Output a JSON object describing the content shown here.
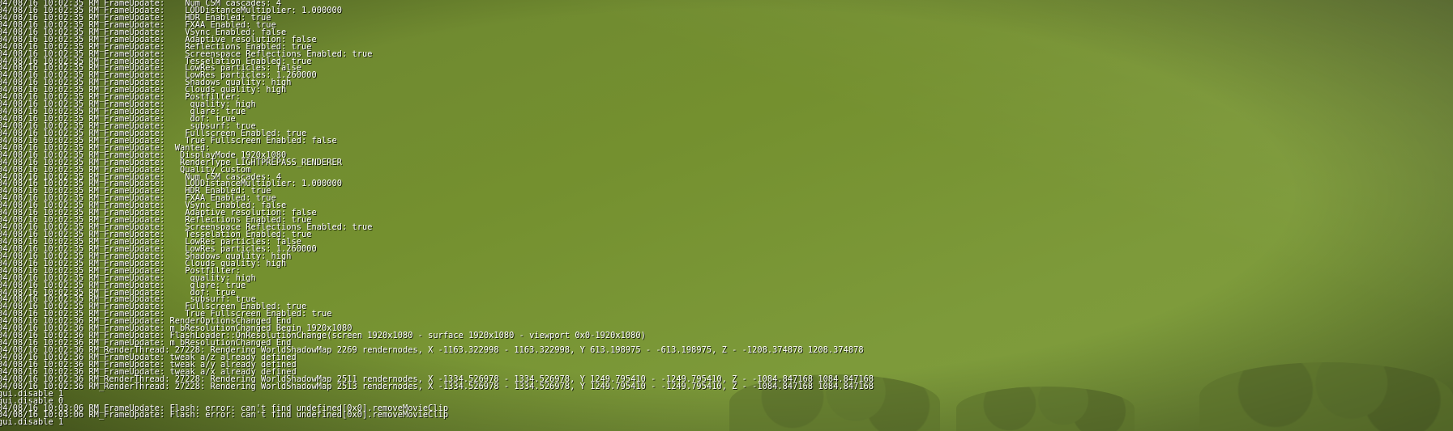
{
  "log_lines": [
    "04/08/16 10:02:35 RM_FrameUpdate:    Num CSM cascades: 4",
    "04/08/16 10:02:35 RM_FrameUpdate:    LODDistanceMultiplier: 1.000000",
    "04/08/16 10:02:35 RM_FrameUpdate:    HDR Enabled: true",
    "04/08/16 10:02:35 RM_FrameUpdate:    FXAA Enabled: true",
    "04/08/16 10:02:35 RM_FrameUpdate:    VSync Enabled: false",
    "04/08/16 10:02:35 RM_FrameUpdate:    Adaptive resolution: false",
    "04/08/16 10:02:35 RM_FrameUpdate:    Reflections Enabled: true",
    "04/08/16 10:02:35 RM_FrameUpdate:    Screenspace Reflections Enabled: true",
    "04/08/16 10:02:35 RM_FrameUpdate:    Tesselation Enabled: true",
    "04/08/16 10:02:35 RM_FrameUpdate:    LowRes particles: false",
    "04/08/16 10:02:35 RM_FrameUpdate:    LowRes particles: 1.260000",
    "04/08/16 10:02:35 RM_FrameUpdate:    Shadows quality: high",
    "04/08/16 10:02:35 RM_FrameUpdate:    Clouds quality: high",
    "04/08/16 10:02:35 RM_FrameUpdate:    Postfilter:",
    "04/08/16 10:02:35 RM_FrameUpdate:     quality: high",
    "04/08/16 10:02:35 RM_FrameUpdate:     glare: true",
    "04/08/16 10:02:35 RM_FrameUpdate:     dof: true",
    "04/08/16 10:02:35 RM_FrameUpdate:     subsurf: true",
    "04/08/16 10:02:35 RM_FrameUpdate:    Fullscreen Enabled: true",
    "04/08/16 10:02:35 RM_FrameUpdate:    True Fullscreen Enabled: false",
    "04/08/16 10:02:35 RM_FrameUpdate:  Wanted:",
    "04/08/16 10:02:35 RM_FrameUpdate:   DisplayMode 1920x1080",
    "04/08/16 10:02:35 RM_FrameUpdate:   RenderType LIGHTPREPASS_RENDERER",
    "04/08/16 10:02:35 RM_FrameUpdate:   Quality custom",
    "04/08/16 10:02:35 RM_FrameUpdate:    Num CSM cascades: 4",
    "04/08/16 10:02:35 RM_FrameUpdate:    LODDistanceMultiplier: 1.000000",
    "04/08/16 10:02:35 RM_FrameUpdate:    HDR Enabled: true",
    "04/08/16 10:02:35 RM_FrameUpdate:    FXAA Enabled: true",
    "04/08/16 10:02:35 RM_FrameUpdate:    VSync Enabled: false",
    "04/08/16 10:02:35 RM_FrameUpdate:    Adaptive resolution: false",
    "04/08/16 10:02:35 RM_FrameUpdate:    Reflections Enabled: true",
    "04/08/16 10:02:35 RM_FrameUpdate:    Screenspace Reflections Enabled: true",
    "04/08/16 10:02:35 RM_FrameUpdate:    Tesselation Enabled: true",
    "04/08/16 10:02:35 RM_FrameUpdate:    LowRes particles: false",
    "04/08/16 10:02:35 RM_FrameUpdate:    LowRes particles: 1.260000",
    "04/08/16 10:02:35 RM_FrameUpdate:    Shadows quality: high",
    "04/08/16 10:02:35 RM_FrameUpdate:    Clouds quality: high",
    "04/08/16 10:02:35 RM_FrameUpdate:    Postfilter:",
    "04/08/16 10:02:35 RM_FrameUpdate:     quality: high",
    "04/08/16 10:02:35 RM_FrameUpdate:     glare: true",
    "04/08/16 10:02:35 RM_FrameUpdate:     dof: true",
    "04/08/16 10:02:35 RM_FrameUpdate:     subsurf: true",
    "04/08/16 10:02:35 RM_FrameUpdate:    Fullscreen Enabled: true",
    "04/08/16 10:02:35 RM_FrameUpdate:    True Fullscreen Enabled: true",
    "04/08/16 10:02:36 RM_FrameUpdate: RenderOptionsChanged End",
    "04/08/16 10:02:36 RM_FrameUpdate: m_bResolutionChanged Begin 1920x1080",
    "04/08/16 10:02:36 RM_FrameUpdate: FlashLoader::OnResolutionChange(screen 1920x1080 - surface 1920x1080 - viewport 0x0-1920x1080)",
    "04/08/16 10:02:36 RM_FrameUpdate: m_bResolutionChanged End",
    "04/08/16 10:02:36 RM_RenderThread: 27228: Rendering WorldShadowMap 2269 rendernodes, X -1163.322998 - 1163.322998, Y 613.198975 - -613.198975, Z - -1208.374878 1208.374878",
    "04/08/16 10:02:36 RM_FrameUpdate: tweak a/z already defined",
    "04/08/16 10:02:36 RM_FrameUpdate: tweak a/y already defined",
    "04/08/16 10:02:36 RM_FrameUpdate: tweak a/x already defined",
    "04/08/16 10:02:36 RM_RenderThread: 27228: Rendering WorldShadowMap 2511 rendernodes, X -1334.526978 - 1334.526978, Y 1249.795410 - -1249.795410, Z - -1084.847168 1084.847168",
    "04/08/16 10:02:36 RM_RenderThread: 27228: Rendering WorldShadowMap 2513 rendernodes, X -1334.526978 - 1334.526978, Y 1249.795410 - -1249.795410, Z - -1084.847168 1084.847168",
    "gui.disable 1",
    "gui.disable 0",
    "04/08/16 10:03:06 RM_FrameUpdate: Flash: error: can't find undefined[0x0].removeMovieClip",
    "04/08/16 10:03:06 RM_FrameUpdate: Flash: error: can't find undefined[0x0].removeMovieClip",
    "gui.disable 1"
  ]
}
